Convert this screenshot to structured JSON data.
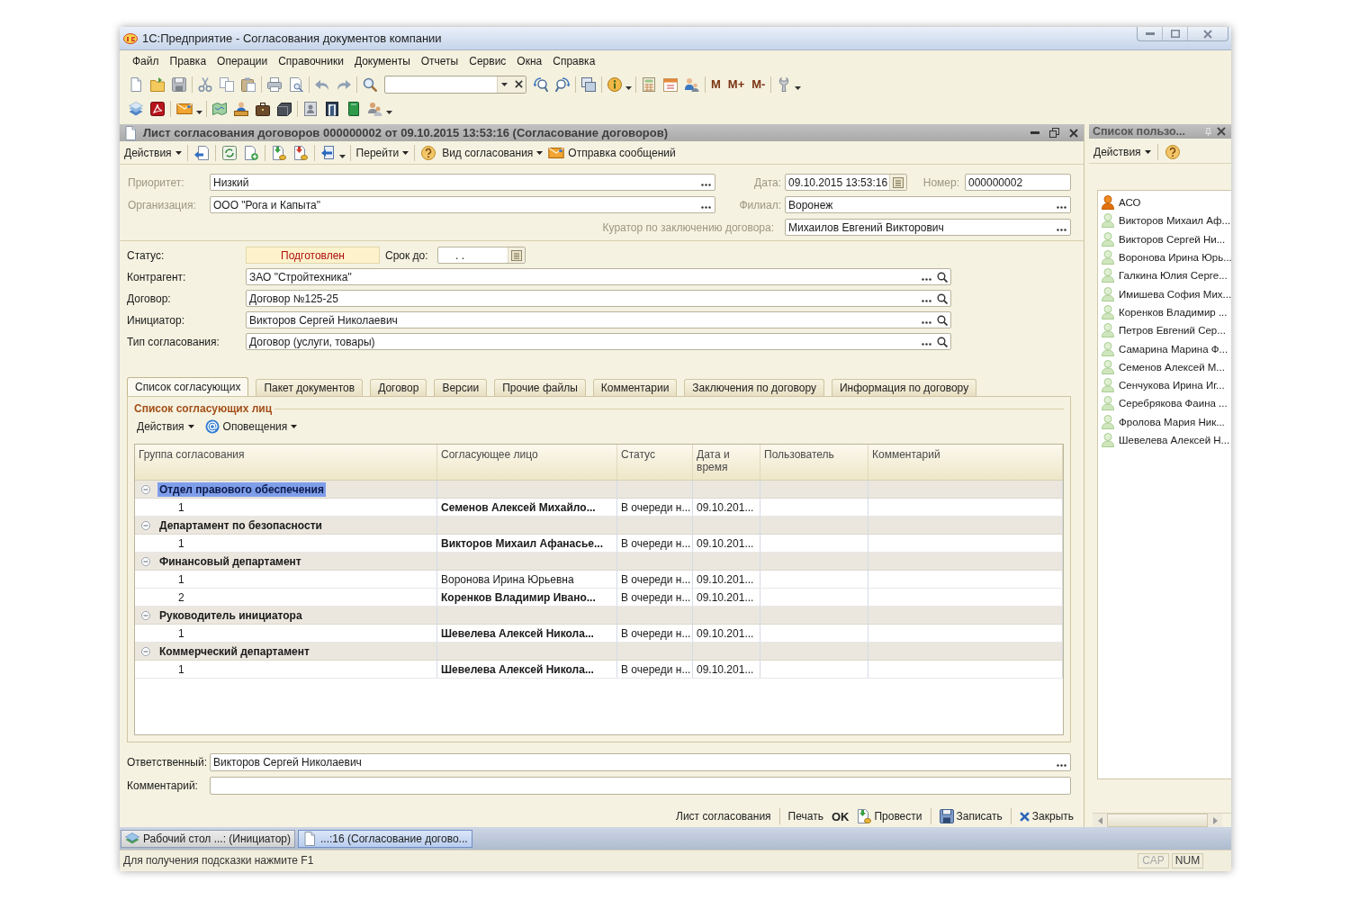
{
  "window": {
    "title": "1С:Предприятие - Согласования документов компании"
  },
  "menu": [
    "Файл",
    "Правка",
    "Операции",
    "Справочники",
    "Документы",
    "Отчеты",
    "Сервис",
    "Окна",
    "Справка"
  ],
  "toolbar": {
    "memory_buttons": [
      "M",
      "M+",
      "M-"
    ]
  },
  "document": {
    "title": "Лист согласования договоров 000000002 от 09.10.2015 13:53:16 (Согласование договоров)",
    "toolbar": {
      "actions": "Действия",
      "go_to": "Перейти",
      "approval_view": "Вид согласования",
      "send_messages": "Отправка сообщений"
    },
    "header": {
      "priority": {
        "label": "Приоритет:",
        "value": "Низкий"
      },
      "date": {
        "label": "Дата:",
        "value": "09.10.2015 13:53:16"
      },
      "number": {
        "label": "Номер:",
        "value": "000000002"
      },
      "organization": {
        "label": "Организация:",
        "value": "ООО \"Рога и Капыта\""
      },
      "branch": {
        "label": "Филиал:",
        "value": "Воронеж"
      },
      "curator": {
        "label": "Куратор по заключению договора:",
        "value": "Михаилов Евгений Викторович"
      }
    },
    "status": {
      "label": "Статус:",
      "value": "Подготовлен"
    },
    "deadline": {
      "label": "Срок до:",
      "value": ". ."
    },
    "fields": [
      {
        "label": "Контрагент:",
        "value": "ЗАО \"Стройтехника\""
      },
      {
        "label": "Договор:",
        "value": "Договор №125-25"
      },
      {
        "label": "Инициатор:",
        "value": "Викторов Сергей Николаевич"
      },
      {
        "label": "Тип согласования:",
        "value": "Договор (услуги, товары)"
      }
    ],
    "tabs": [
      {
        "label": "Список согласующих",
        "selected": true
      },
      {
        "label": "Пакет документов",
        "selected": false
      },
      {
        "label": "Договор",
        "selected": false
      },
      {
        "label": "Версии",
        "selected": false
      },
      {
        "label": "Прочие файлы",
        "selected": false
      },
      {
        "label": "Комментарии",
        "selected": false
      },
      {
        "label": "Заключения по договору",
        "selected": false
      },
      {
        "label": "Информация по договору",
        "selected": false
      }
    ],
    "approvers": {
      "title": "Список согласующих лиц",
      "toolbar": {
        "actions": "Действия",
        "notifications": "Оповещения"
      },
      "columns": [
        "Группа согласования",
        "Согласующее лицо",
        "Статус",
        "Дата и время",
        "Пользователь",
        "Комментарий"
      ],
      "groups": [
        {
          "name": "Отдел правового обеспечения",
          "selected": true,
          "expanded": true,
          "children": [
            {
              "number": "1",
              "person": "Семенов Алексей Михайло...",
              "bold": true,
              "status": "В очереди н...",
              "datetime": "09.10.201...",
              "selected": false
            }
          ]
        },
        {
          "name": "Департамент по безопасности",
          "selected": false,
          "expanded": true,
          "children": [
            {
              "number": "1",
              "person": "Викторов Михаил Афанасье...",
              "bold": true,
              "status": "В очереди н...",
              "datetime": "09.10.201...",
              "selected": false
            }
          ]
        },
        {
          "name": "Финансовый департамент",
          "selected": false,
          "expanded": true,
          "children": [
            {
              "number": "1",
              "person": "Воронова Ирина Юрьевна",
              "bold": false,
              "status": "В очереди н...",
              "datetime": "09.10.201...",
              "selected": false
            },
            {
              "number": "2",
              "person": "Коренков Владимир Ивано...",
              "bold": true,
              "status": "В очереди н...",
              "datetime": "09.10.201...",
              "selected": false
            }
          ]
        },
        {
          "name": "Руководитель инициатора",
          "selected": false,
          "expanded": true,
          "children": [
            {
              "number": "1",
              "person": "Шевелева Алексей Никола...",
              "bold": true,
              "status": "В очереди н...",
              "datetime": "09.10.201...",
              "selected": false
            }
          ]
        },
        {
          "name": "Коммерческий департамент",
          "selected": false,
          "expanded": true,
          "children": [
            {
              "number": "1",
              "person": "Шевелева Алексей Никола...",
              "bold": true,
              "status": "В очереди н...",
              "datetime": "09.10.201...",
              "selected": false
            }
          ]
        }
      ]
    },
    "responsible": {
      "label": "Ответственный:",
      "value": "Викторов Сергей Николаевич"
    },
    "comment": {
      "label": "Комментарий:"
    },
    "buttons": [
      {
        "kind": "text",
        "label": "Лист согласования"
      },
      {
        "kind": "plain",
        "label": "Печать"
      },
      {
        "kind": "default",
        "label": "OK"
      },
      {
        "kind": "post",
        "label": "Провести"
      },
      {
        "kind": "save",
        "label": "Записать"
      },
      {
        "kind": "close",
        "label": "Закрыть"
      }
    ]
  },
  "users_panel": {
    "title": "Список пользо...",
    "toolbar": {
      "actions": "Действия"
    },
    "users": [
      {
        "name": "АСО",
        "kind": "admin"
      },
      {
        "name": "Викторов Михаил Аф...",
        "kind": "user"
      },
      {
        "name": "Викторов Сергей Ни...",
        "kind": "user"
      },
      {
        "name": "Воронова Ирина Юрь...",
        "kind": "user"
      },
      {
        "name": "Галкина Юлия Серге...",
        "kind": "user"
      },
      {
        "name": "Имишева София Мих...",
        "kind": "user"
      },
      {
        "name": "Коренков Владимир ...",
        "kind": "user"
      },
      {
        "name": "Петров Евгений Сер...",
        "kind": "user"
      },
      {
        "name": "Самарина Марина Ф...",
        "kind": "user"
      },
      {
        "name": "Семенов Алексей М...",
        "kind": "user"
      },
      {
        "name": "Сенчукова Ирина Иг...",
        "kind": "user"
      },
      {
        "name": "Серебрякова Фаина ...",
        "kind": "user"
      },
      {
        "name": "Фролова Мария Ник...",
        "kind": "user"
      },
      {
        "name": "Шевелева Алексей Н...",
        "kind": "user"
      }
    ]
  },
  "taskbar": [
    {
      "label": "Рабочий стол ...: (Инициатор)",
      "kind": "desktop",
      "selected": false
    },
    {
      "label": "...:16 (Согласование догово...",
      "kind": "document",
      "selected": true
    }
  ],
  "status_bar": {
    "hint": "Для получения подсказки нажмите F1",
    "indicators": [
      {
        "label": "CAP",
        "on": false
      },
      {
        "label": "NUM",
        "on": true
      }
    ]
  }
}
